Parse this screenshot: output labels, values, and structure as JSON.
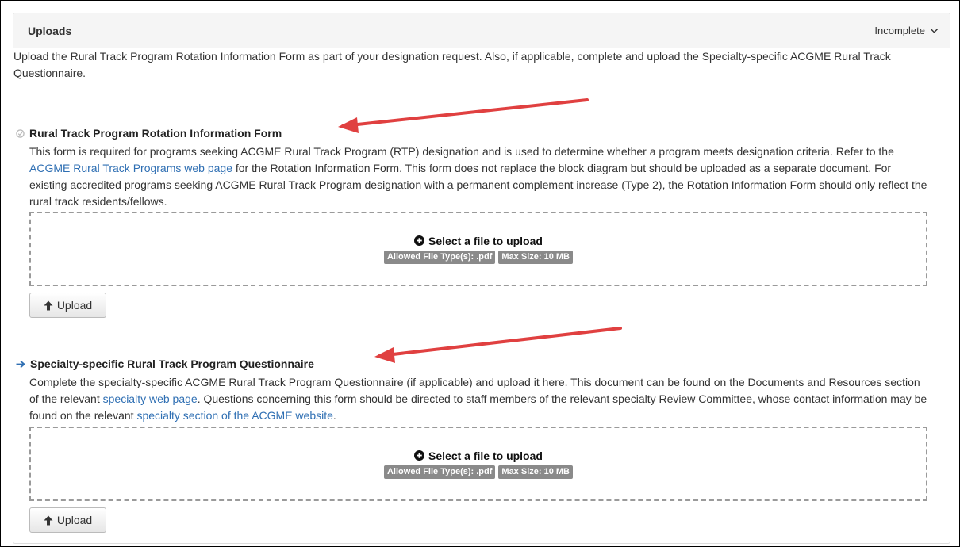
{
  "panel": {
    "title": "Uploads",
    "status": "Incomplete"
  },
  "intro_text": "Upload the Rural Track Program Rotation Information Form as part of your designation request. Also, if applicable, complete and upload the Specialty-specific ACGME Rural Track Questionnaire.",
  "sections": [
    {
      "title": "Rural Track Program Rotation Information Form",
      "status_icon": "circle-check-icon",
      "desc_part1": "This form is required for programs seeking ACGME Rural Track Program (RTP) designation and is used to determine whether a program meets designation criteria. Refer to the ",
      "link1": "ACGME Rural Track Programs web page",
      "desc_part2": " for the Rotation Information Form. This form does not replace the block diagram but should be uploaded as a separate document. For existing accredited programs seeking ACGME Rural Track Program designation with a permanent complement increase (Type 2), the Rotation Information Form should only reflect the rural track residents/fellows.",
      "dropzone": {
        "select_label": "Select a file to upload",
        "file_types": "Allowed File Type(s): .pdf",
        "max_size": "Max Size: 10 MB"
      },
      "upload_label": "Upload"
    },
    {
      "title": "Specialty-specific Rural Track Program Questionnaire",
      "status_icon": "arrow-right-icon",
      "desc_part1": "Complete the specialty-specific ACGME Rural Track Program Questionnaire (if applicable) and upload it here. This document can be found on the Documents and Resources section of the relevant ",
      "link1": "specialty web page",
      "desc_part2": ". Questions concerning this form should be directed to staff members of the relevant specialty Review Committee, whose contact information may be found on the relevant ",
      "link2": "specialty section of the ACGME website",
      "desc_part3": ".",
      "dropzone": {
        "select_label": "Select a file to upload",
        "file_types": "Allowed File Type(s): .pdf",
        "max_size": "Max Size: 10 MB"
      },
      "upload_label": "Upload"
    }
  ],
  "colors": {
    "link": "#2f6fb3",
    "annotation_arrow": "#e04040",
    "badge": "#8a8a8a"
  }
}
